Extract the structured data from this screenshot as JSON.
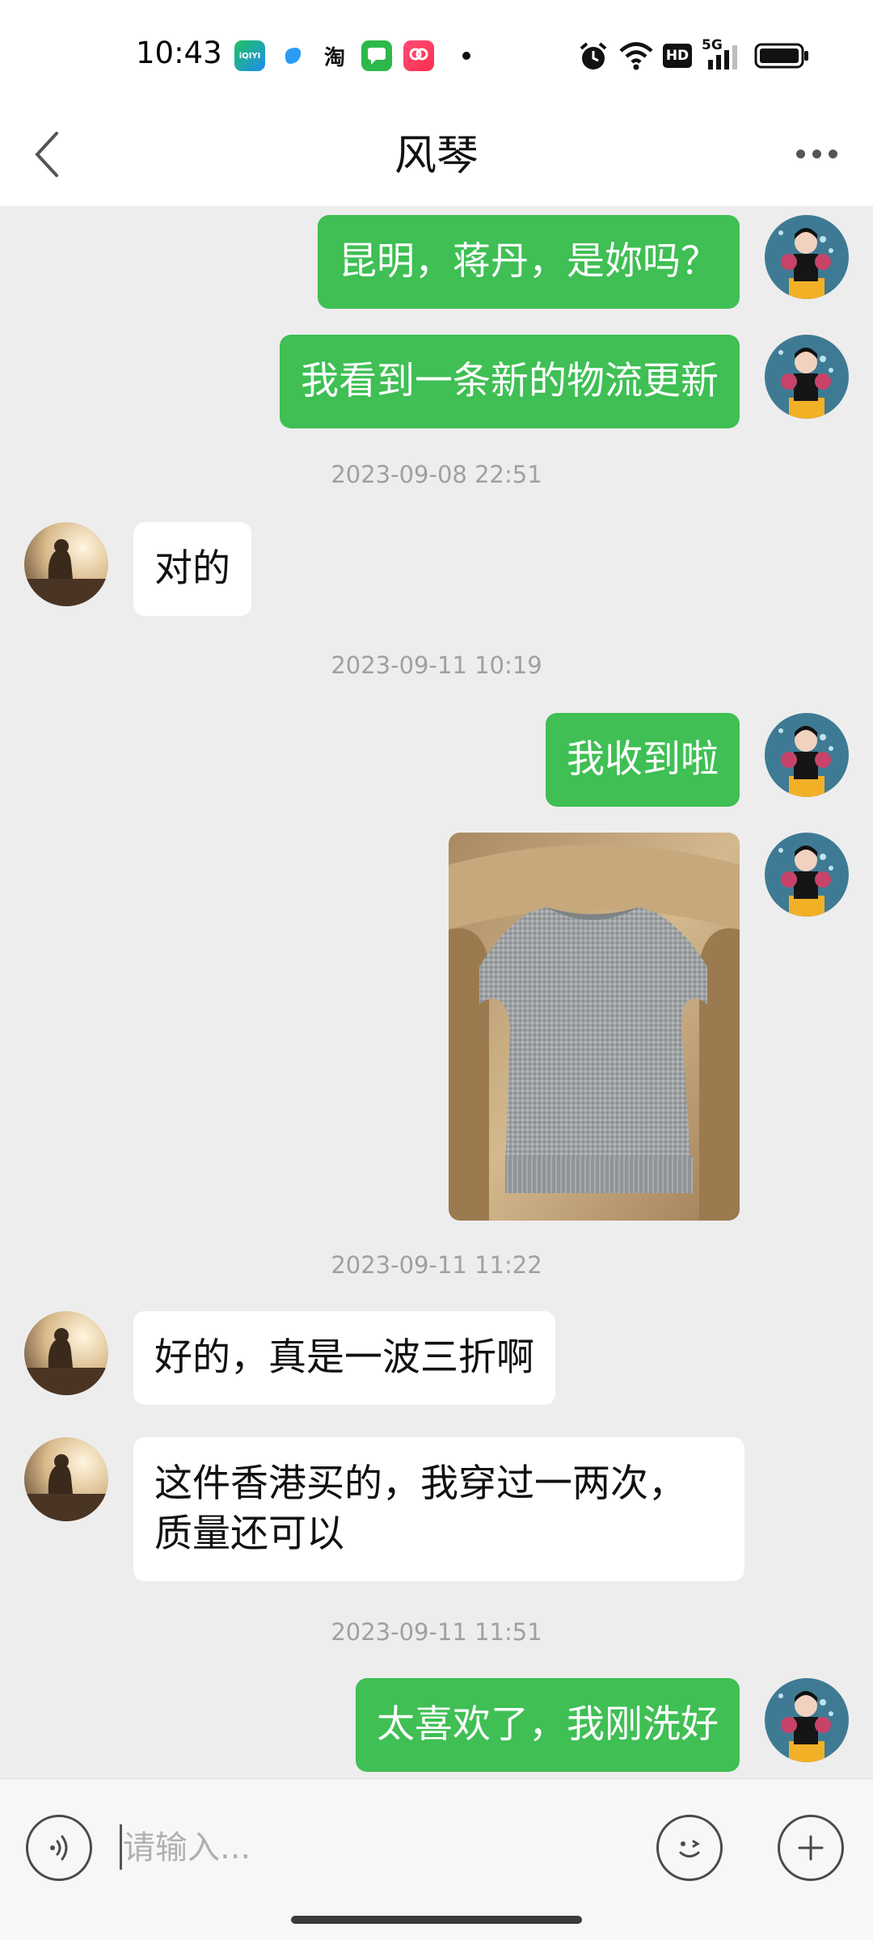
{
  "status_bar": {
    "time": "10:43",
    "apps": [
      "iQIYI",
      "Tieba",
      "淘",
      "Messages",
      "Pinduoduo"
    ],
    "network": "5G",
    "hd": "HD"
  },
  "nav": {
    "title": "风琴",
    "back_icon": "chevron-left-icon",
    "more_icon": "more-icon"
  },
  "messages": [
    {
      "from": "me",
      "text": "昆明，蒋丹，是妳吗？"
    },
    {
      "from": "me",
      "text": "我看到一条新的物流更新"
    },
    {
      "type": "timestamp",
      "text": "2023-09-08 22:51"
    },
    {
      "from": "them",
      "text": "对的"
    },
    {
      "type": "timestamp",
      "text": "2023-09-11 10:19"
    },
    {
      "from": "me",
      "text": "我收到啦"
    },
    {
      "from": "me",
      "type": "image",
      "alt": "grey knitted vest photo"
    },
    {
      "type": "timestamp",
      "text": "2023-09-11 11:22"
    },
    {
      "from": "them",
      "text": "好的，真是一波三折啊"
    },
    {
      "from": "them",
      "text": "这件香港买的，我穿过一两次，",
      "text2": "质量还可以"
    },
    {
      "type": "timestamp",
      "text": "2023-09-11 11:51"
    },
    {
      "from": "me",
      "text": "太喜欢了，我刚洗好"
    }
  ],
  "input_bar": {
    "placeholder": "请输入...",
    "voice_icon": "voice-icon",
    "emoji_icon": "emoji-icon",
    "plus_icon": "plus-icon"
  },
  "colors": {
    "my_bubble": "#3FBF54",
    "their_bubble": "#FFFFFF",
    "chat_bg": "#EDEDED"
  }
}
